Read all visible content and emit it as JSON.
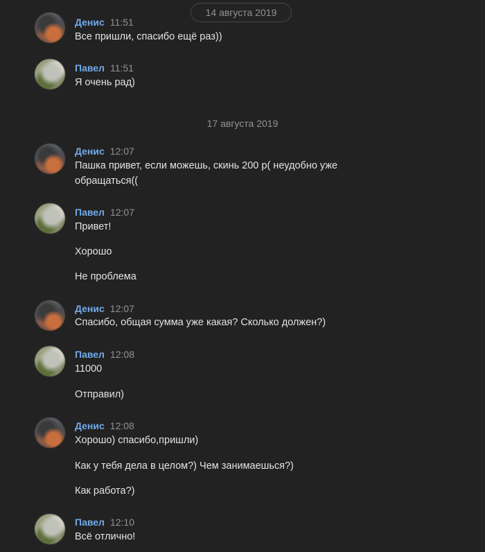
{
  "sticky_date": "14 августа 2019",
  "date_separator": "17 августа 2019",
  "groups": [
    {
      "author": "Денис",
      "time": "11:51",
      "messages": [
        "Все пришли, спасибо ещё раз))"
      ]
    },
    {
      "author": "Павел",
      "time": "11:51",
      "messages": [
        "Я очень рад)"
      ]
    },
    {
      "author": "Денис",
      "time": "12:07",
      "messages": [
        "Пашка привет, если можешь, скинь 200 р( неудобно уже обращаться(("
      ]
    },
    {
      "author": "Павел",
      "time": "12:07",
      "messages": [
        "Привет!",
        "Хорошо",
        "Не проблема"
      ]
    },
    {
      "author": "Денис",
      "time": "12:07",
      "messages": [
        "Спасибо, общая сумма уже какая? Сколько должен?)"
      ]
    },
    {
      "author": "Павел",
      "time": "12:08",
      "messages": [
        "11000",
        "Отправил)"
      ]
    },
    {
      "author": "Денис",
      "time": "12:08",
      "messages": [
        "Хорошо) спасибо,пришли)",
        "Как у тебя дела в целом?) Чем занимаешься?)",
        "Как работа?)"
      ]
    },
    {
      "author": "Павел",
      "time": "12:10",
      "messages": [
        "Всё отлично!"
      ]
    }
  ]
}
